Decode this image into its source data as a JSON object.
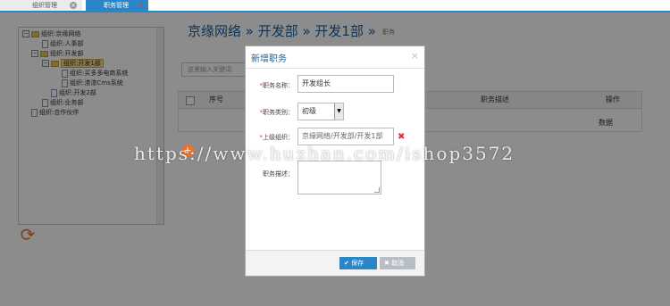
{
  "tabs": [
    {
      "label": "组织管理"
    },
    {
      "label": "职务管理"
    }
  ],
  "tree": {
    "items": [
      {
        "label": "组织:京缘网络",
        "level": 0,
        "expanded": true,
        "selected": false
      },
      {
        "label": "组织:人事部",
        "level": 1,
        "expanded": false,
        "selected": false
      },
      {
        "label": "组织:开发部",
        "level": 1,
        "expanded": true,
        "selected": false
      },
      {
        "label": "组织:开发1部",
        "level": 2,
        "expanded": true,
        "selected": true
      },
      {
        "label": "组织:买多多电商系统",
        "level": 3,
        "expanded": false,
        "selected": false
      },
      {
        "label": "组织:渣渣Cms系统",
        "level": 3,
        "expanded": false,
        "selected": false
      },
      {
        "label": "组织:开发2部",
        "level": 2,
        "expanded": false,
        "selected": false
      },
      {
        "label": "组织:业务部",
        "level": 1,
        "expanded": false,
        "selected": false
      },
      {
        "label": "组织:合作伙伴",
        "level": 0,
        "expanded": false,
        "selected": false
      }
    ]
  },
  "breadcrumb": {
    "path": "京缘网络 » 开发部 » 开发1部 »",
    "section": "职务"
  },
  "search": {
    "placeholder": "这里输入关键词"
  },
  "table": {
    "columns": [
      "序号",
      "职务描述",
      "操作"
    ],
    "empty_text": "数据"
  },
  "dialog": {
    "title": "新增职务",
    "close": "×",
    "fields": {
      "name_label": "职务名称：",
      "name_value": "开发组长",
      "category_label": "职务类别：",
      "category_value": "初级",
      "parent_label": "上级组织：",
      "parent_value": "京缘网络/开发部/开发1部",
      "desc_label": "职务描述：",
      "required_mark": "*"
    },
    "save_label": "保存",
    "cancel_label": "取消"
  },
  "watermark": "https://www.huzhan.com/ishop3572",
  "colors": {
    "accent": "#2a86c7",
    "title": "#1d5f98",
    "warning": "#e8752a"
  }
}
